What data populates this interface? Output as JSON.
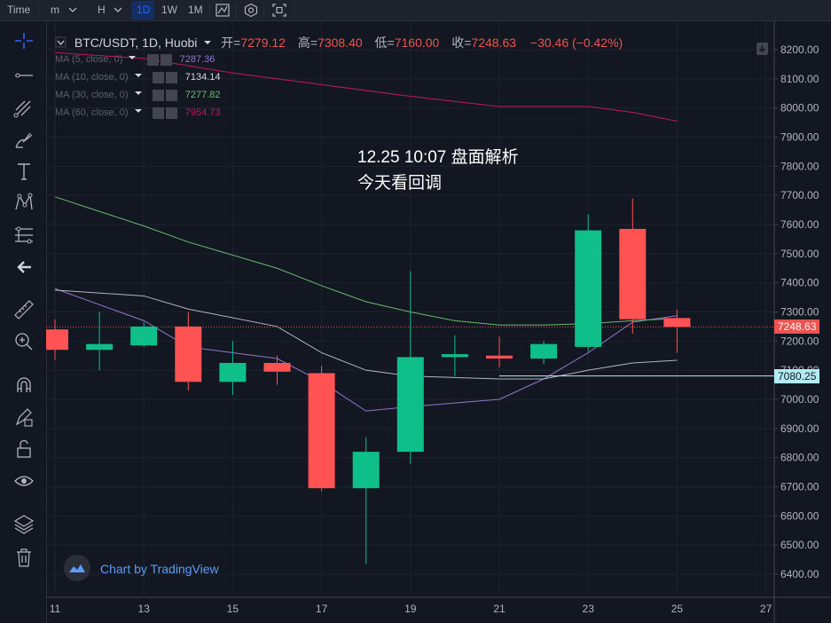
{
  "toolbar": {
    "time_label": "Time",
    "interval_m": "m",
    "interval_h": "H",
    "interval_1d": "1D",
    "interval_1w": "1W",
    "interval_1m": "1M"
  },
  "legend": {
    "symbol": "BTC/USDT, 1D, Huobi",
    "open_label": "开=",
    "open": "7279.12",
    "high_label": "高=",
    "high": "7308.40",
    "low_label": "低=",
    "low": "7160.00",
    "close_label": "收=",
    "close": "7248.63",
    "change": "−30.46 (−0.42%)",
    "ma": [
      {
        "label": "MA (5, close, 0)",
        "value": "7287.36",
        "color": "#9575cd"
      },
      {
        "label": "MA (10, close, 0)",
        "value": "7134.14",
        "color": "#b2b5be"
      },
      {
        "label": "MA (30, close, 0)",
        "value": "7277.82",
        "color": "#66bb6a"
      },
      {
        "label": "MA (60, close, 0)",
        "value": "7954.73",
        "color": "#c2185b"
      }
    ]
  },
  "annotation": {
    "line1": "12.25 10:07 盘面解析",
    "line2": "今天看回调"
  },
  "price_tags": {
    "last": "7248.63",
    "line": "7080.25"
  },
  "watermark": {
    "text": "Chart by TradingView"
  },
  "colors": {
    "up": "#26a69a",
    "up_fill": "#0fbf8a",
    "down": "#ef5350",
    "down_fill": "#ff5252",
    "background": "#131722",
    "grid": "#2a2e39",
    "accent": "#2962ff"
  },
  "chart_data": {
    "type": "candlestick",
    "title": "BTC/USDT, 1D, Huobi",
    "x_ticks": [
      "11",
      "13",
      "15",
      "17",
      "19",
      "21",
      "23",
      "25",
      "27"
    ],
    "y_ticks": [
      "6400.00",
      "6500.00",
      "6600.00",
      "6700.00",
      "6800.00",
      "6900.00",
      "7000.00",
      "7100.00",
      "7200.00",
      "7300.00",
      "7400.00",
      "7500.00",
      "7600.00",
      "7700.00",
      "7800.00",
      "7900.00",
      "8000.00",
      "8100.00",
      "8200.00"
    ],
    "ylim": [
      6370,
      8250
    ],
    "xlim": [
      11,
      27.2
    ],
    "candles": [
      {
        "day": 11,
        "open": 7240,
        "high": 7275,
        "low": 7135,
        "close": 7170
      },
      {
        "day": 12,
        "open": 7170,
        "high": 7300,
        "low": 7100,
        "close": 7190
      },
      {
        "day": 13,
        "open": 7185,
        "high": 7265,
        "low": 7180,
        "close": 7250
      },
      {
        "day": 14,
        "open": 7250,
        "high": 7300,
        "low": 7030,
        "close": 7060
      },
      {
        "day": 15,
        "open": 7060,
        "high": 7200,
        "low": 7015,
        "close": 7125
      },
      {
        "day": 16,
        "open": 7125,
        "high": 7150,
        "low": 7050,
        "close": 7095
      },
      {
        "day": 17,
        "open": 7090,
        "high": 7115,
        "low": 6685,
        "close": 6695
      },
      {
        "day": 18,
        "open": 6695,
        "high": 6870,
        "low": 6435,
        "close": 6820
      },
      {
        "day": 19,
        "open": 6820,
        "high": 7440,
        "low": 6780,
        "close": 7145
      },
      {
        "day": 20,
        "open": 7145,
        "high": 7220,
        "low": 7080,
        "close": 7155
      },
      {
        "day": 21,
        "open": 7150,
        "high": 7215,
        "low": 7110,
        "close": 7140
      },
      {
        "day": 22,
        "open": 7140,
        "high": 7200,
        "low": 7120,
        "close": 7190
      },
      {
        "day": 23,
        "open": 7180,
        "high": 7635,
        "low": 7165,
        "close": 7580
      },
      {
        "day": 24,
        "open": 7585,
        "high": 7690,
        "low": 7225,
        "close": 7275
      },
      {
        "day": 25,
        "open": 7279.12,
        "high": 7308.4,
        "low": 7160,
        "close": 7248.63
      }
    ],
    "series": [
      {
        "name": "MA (5, close, 0)",
        "color": "#9575cd",
        "x": [
          11,
          13,
          14,
          16,
          17,
          18,
          19,
          21,
          22,
          23,
          24,
          25
        ],
        "values": [
          7380,
          7270,
          7180,
          7140,
          7060,
          6960,
          6975,
          7000,
          7070,
          7160,
          7265,
          7287.36
        ]
      },
      {
        "name": "MA (10, close, 0)",
        "color": "#b2b5be",
        "x": [
          11,
          13,
          14,
          16,
          17,
          18,
          19,
          21,
          22,
          23,
          24,
          25
        ],
        "values": [
          7375,
          7355,
          7310,
          7250,
          7160,
          7100,
          7080,
          7070,
          7070,
          7100,
          7125,
          7134.14
        ]
      },
      {
        "name": "MA (30, close, 0)",
        "color": "#66bb6a",
        "x": [
          11,
          13,
          14,
          16,
          17,
          18,
          19,
          20,
          21,
          22,
          23,
          24,
          25
        ],
        "values": [
          7695,
          7595,
          7540,
          7450,
          7390,
          7335,
          7300,
          7270,
          7255,
          7255,
          7260,
          7270,
          7277.82
        ]
      },
      {
        "name": "MA (60, close, 0)",
        "color": "#c2185b",
        "x": [
          11,
          13,
          15,
          17,
          19,
          21,
          23,
          24,
          25
        ],
        "values": [
          8190,
          8170,
          8120,
          8080,
          8040,
          8005,
          8005,
          7985,
          7954.73
        ]
      }
    ],
    "horizontal_lines": [
      {
        "value": 7248.63,
        "style": "dotted",
        "color": "#ef5350"
      },
      {
        "value": 7080.25,
        "from_day": 21,
        "style": "solid",
        "color": "#b2ebf2"
      }
    ],
    "grid": true
  }
}
